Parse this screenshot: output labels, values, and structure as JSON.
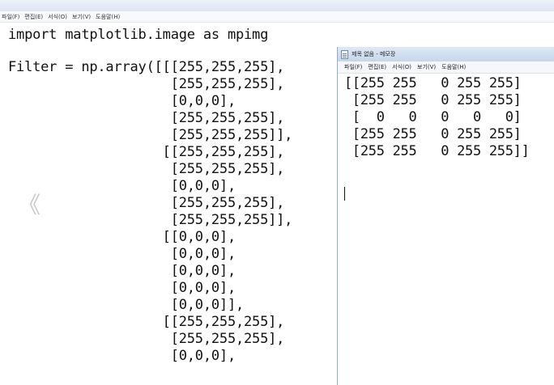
{
  "background_window": {
    "menu": [
      "파일(F)",
      "편집(E)",
      "서식(O)",
      "보기(V)",
      "도움말(H)"
    ],
    "code_lines": [
      "import matplotlib.image as mpimg",
      "",
      "Filter = np.array([[[255,255,255],",
      "                    [255,255,255],",
      "                    [0,0,0],",
      "                    [255,255,255],",
      "                    [255,255,255]],",
      "                   [[255,255,255],",
      "                    [255,255,255],",
      "                    [0,0,0],",
      "                    [255,255,255],",
      "                    [255,255,255]],",
      "                   [[0,0,0],",
      "                    [0,0,0],",
      "                    [0,0,0],",
      "                    [0,0,0],",
      "                    [0,0,0]],",
      "                   [[255,255,255],",
      "                    [255,255,255],",
      "                    [0,0,0],"
    ],
    "left_nav_glyph": "《"
  },
  "foreground_window": {
    "title": "제목 없음 - 메모장",
    "menu": [
      "파일(F)",
      "편집(E)",
      "서식(O)",
      "보기(V)",
      "도움말(H)"
    ],
    "content_lines": [
      "[[255 255   0 255 255]",
      " [255 255   0 255 255]",
      " [  0   0   0   0   0]",
      " [255 255   0 255 255]",
      " [255 255   0 255 255]]"
    ]
  },
  "icons": {
    "notepad_app_icon": "notepad-icon",
    "left_nav": "chevron-left-icon"
  }
}
